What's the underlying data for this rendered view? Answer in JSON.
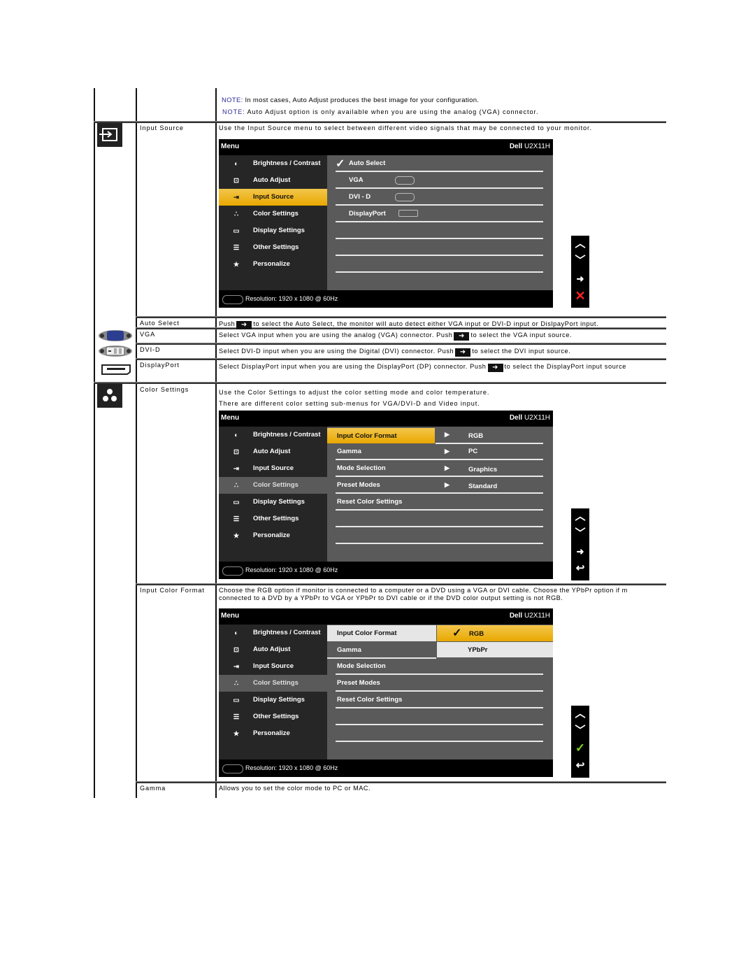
{
  "notes": [
    {
      "key": "NOTE:",
      "text": " In most cases, Auto Adjust produces the best image for your configuration."
    },
    {
      "key": "NOTE:",
      "text": " Auto Adjust option is only available when you are using the analog (VGA) connector."
    }
  ],
  "rows": {
    "input_source": {
      "icon": "input-source-icon",
      "label": "Input Source",
      "desc": "Use the Input Source menu to select between different video signals that may be connected to your monitor."
    },
    "auto_select": {
      "label": "Auto Select",
      "desc_pre": "Push",
      "desc_post": "to select the Auto Select, the monitor will auto detect either VGA input or DVI-D input or DislpayPort input."
    },
    "vga": {
      "label": "VGA",
      "icon": "vga-connector-icon",
      "desc_pre": "Select VGA input when you are using the analog (VGA) connector. Push",
      "desc_post": "to select the VGA input source."
    },
    "dvi": {
      "label": "DVI-D",
      "icon": "dvi-connector-icon",
      "desc_pre": "Select DVI-D input when you are using the Digital (DVI) connector. Push",
      "desc_post": "to select the DVI input source."
    },
    "displayport": {
      "label": "DisplayPort",
      "icon": "displayport-connector-icon",
      "desc_pre": "Select DisplayPort input when you are using the DisplayPort (DP) connector. Push",
      "desc_post": "to select the DisplayPort input source"
    },
    "color_settings": {
      "icon": "color-settings-icon",
      "label": "Color Settings",
      "desc1": "Use the Color Settings to adjust the color setting mode and color temperature.",
      "desc2": "There are different color setting sub-menus for VGA/DVI-D and Video input."
    },
    "input_color_format": {
      "label": "Input Color Format",
      "desc1": "Choose the RGB option if monitor is connected to a computer or a DVD using a VGA or DVI cable. Choose the YPbPr option if m",
      "desc2": "connected to a DVD by a YPbPr to VGA or YPbPr to DVI cable or if the DVD color output setting is not RGB."
    },
    "gamma": {
      "label": "Gamma",
      "desc": "Allows you to set the color mode to PC or MAC."
    }
  },
  "osd": {
    "menu_title": "Menu",
    "brand": "Dell",
    "model": "U2X11H",
    "resolution": "Resolution: 1920 x 1080 @ 60Hz",
    "main_menu": [
      {
        "label": "Brightness / Contrast",
        "icon": "brightness-icon"
      },
      {
        "label": "Auto Adjust",
        "icon": "auto-adjust-icon"
      },
      {
        "label": "Input Source",
        "icon": "input-source-icon"
      },
      {
        "label": "Color Settings",
        "icon": "color-settings-icon"
      },
      {
        "label": "Display Settings",
        "icon": "display-settings-icon"
      },
      {
        "label": "Other Settings",
        "icon": "other-settings-icon"
      },
      {
        "label": "Personalize",
        "icon": "star-icon"
      }
    ],
    "input_submenu": [
      {
        "label": "Auto Select",
        "checked": true
      },
      {
        "label": "VGA"
      },
      {
        "label": "DVI - D"
      },
      {
        "label": "DisplayPort"
      }
    ],
    "color_submenu": [
      {
        "label": "Input Color Format",
        "value": "RGB"
      },
      {
        "label": "Gamma",
        "value": "PC"
      },
      {
        "label": "Mode Selection",
        "value": "Graphics"
      },
      {
        "label": "Preset Modes",
        "value": "Standard"
      },
      {
        "label": "Reset Color Settings",
        "value": ""
      }
    ],
    "color_format_options": [
      "RGB",
      "YPbPr"
    ],
    "nav1": [
      "up",
      "down",
      "enter",
      "exit"
    ],
    "nav2": [
      "up",
      "down",
      "enter",
      "back"
    ],
    "nav3": [
      "up",
      "down",
      "confirm",
      "back"
    ]
  },
  "colors": {
    "highlight": "#f0b400",
    "note": "#2b2b9a",
    "exit": "#ff2020",
    "confirm": "#7ed321"
  }
}
